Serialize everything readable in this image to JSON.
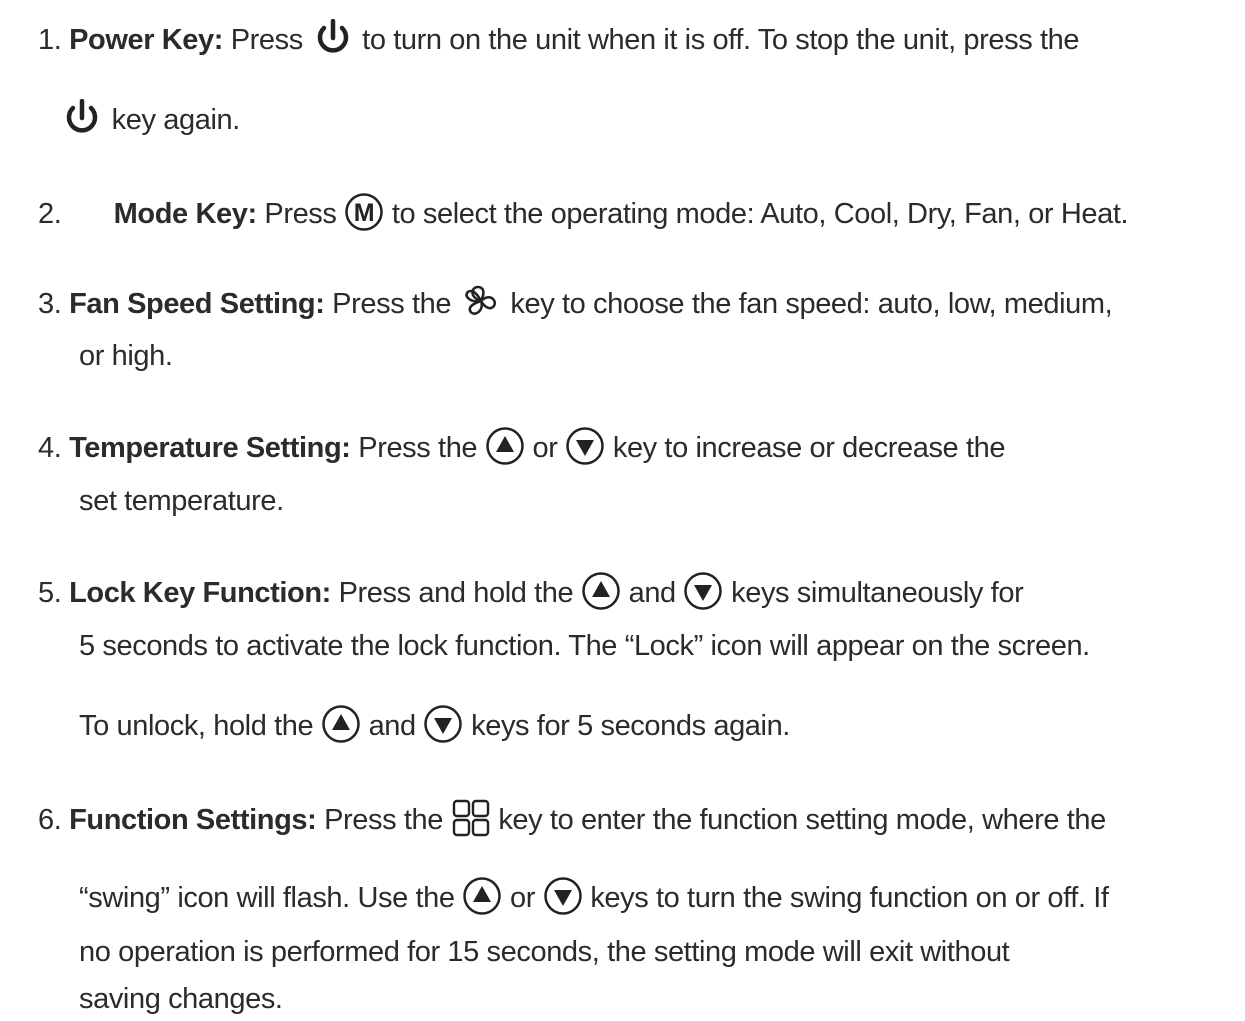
{
  "items": [
    {
      "num": "1.",
      "title": "Power Key:",
      "t1": "Press",
      "t2": "to turn on the unit when it is off. To stop the unit, press the",
      "t3": "key again."
    },
    {
      "num": "2.",
      "title": "Mode Key:",
      "t1": "Press",
      "t2": "to select the operating mode: Auto, Cool, Dry, Fan, or Heat."
    },
    {
      "num": "3.",
      "title": "Fan Speed Setting:",
      "t1": "Press the",
      "t2": "key to choose the fan speed: auto, low, medium,",
      "t3": "or high."
    },
    {
      "num": "4.",
      "title": "Temperature Setting:",
      "t1": "Press the",
      "t2": "or",
      "t3": "key to increase or decrease the",
      "t4": "set temperature."
    },
    {
      "num": "5.",
      "title": "Lock Key Function:",
      "t1": "Press and hold the",
      "t2": "and",
      "t3": "keys simultaneously for",
      "t4": "5 seconds to activate the lock function. The “Lock” icon will appear on the screen.",
      "t5": "To unlock, hold the",
      "t6": "and",
      "t7": "keys for 5 seconds again."
    },
    {
      "num": "6.",
      "title": "Function Settings:",
      "t1": "Press the",
      "t2": "key to enter the function setting mode, where the",
      "t3": "“swing” icon will flash. Use the",
      "t4": "or",
      "t5": "keys to turn the swing function on or off. If",
      "t6": "no operation is performed for 15 seconds, the setting mode will exit without",
      "t7": "saving changes."
    }
  ],
  "icons": {
    "power": "power-icon",
    "mode": "mode-m-icon",
    "fan": "fan-icon",
    "up": "arrow-up-circle-icon",
    "down": "arrow-down-circle-icon",
    "function": "function-grid-icon"
  },
  "mode_icon_letter": "M"
}
